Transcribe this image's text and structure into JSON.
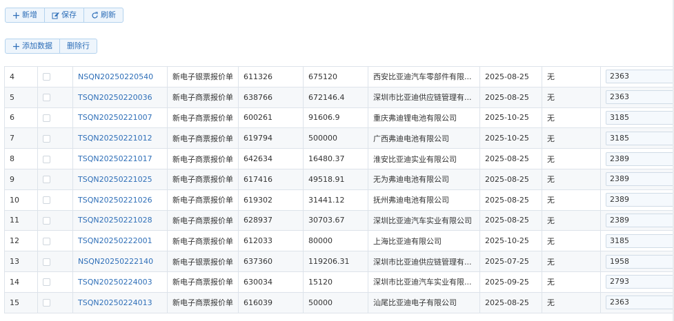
{
  "toolbar": {
    "add_label": "新增",
    "save_label": "保存",
    "refresh_label": "刷新"
  },
  "grid_toolbar": {
    "add_data_label": "添加数据",
    "delete_row_label": "删除行"
  },
  "rows": [
    {
      "num": "4",
      "code": "NSQN20250220540",
      "type": "新电子银票报价单",
      "a": "611326",
      "b": "675120",
      "company": "西安比亚迪汽车零部件有限...",
      "date": "2025-08-25",
      "flag": "无",
      "value": "2363"
    },
    {
      "num": "5",
      "code": "TSQN20250220036",
      "type": "新电子商票报价单",
      "a": "638766",
      "b": "672146.4",
      "company": "深圳市比亚迪供应链管理有...",
      "date": "2025-08-25",
      "flag": "无",
      "value": "2363"
    },
    {
      "num": "6",
      "code": "TSQN20250221007",
      "type": "新电子商票报价单",
      "a": "600261",
      "b": "91606.9",
      "company": "重庆弗迪锂电池有限公司",
      "date": "2025-10-25",
      "flag": "无",
      "value": "3185"
    },
    {
      "num": "7",
      "code": "TSQN20250221012",
      "type": "新电子商票报价单",
      "a": "619794",
      "b": "500000",
      "company": "广西弗迪电池有限公司",
      "date": "2025-10-25",
      "flag": "无",
      "value": "3185"
    },
    {
      "num": "8",
      "code": "TSQN20250221017",
      "type": "新电子商票报价单",
      "a": "642634",
      "b": "16480.37",
      "company": "淮安比亚迪实业有限公司",
      "date": "2025-08-25",
      "flag": "无",
      "value": "2389"
    },
    {
      "num": "9",
      "code": "TSQN20250221025",
      "type": "新电子商票报价单",
      "a": "617416",
      "b": "49518.91",
      "company": "无为弗迪电池有限公司",
      "date": "2025-08-25",
      "flag": "无",
      "value": "2389"
    },
    {
      "num": "10",
      "code": "TSQN20250221026",
      "type": "新电子商票报价单",
      "a": "619302",
      "b": "31441.12",
      "company": "抚州弗迪电池有限公司",
      "date": "2025-08-25",
      "flag": "无",
      "value": "2389"
    },
    {
      "num": "11",
      "code": "TSQN20250221028",
      "type": "新电子商票报价单",
      "a": "628937",
      "b": "30703.67",
      "company": "深圳比亚迪汽车实业有限公司",
      "date": "2025-08-25",
      "flag": "无",
      "value": "2389"
    },
    {
      "num": "12",
      "code": "TSQN20250222001",
      "type": "新电子商票报价单",
      "a": "612033",
      "b": "80000",
      "company": "上海比亚迪有限公司",
      "date": "2025-10-25",
      "flag": "无",
      "value": "3185"
    },
    {
      "num": "13",
      "code": "NSQN20250222140",
      "type": "新电子银票报价单",
      "a": "637360",
      "b": "119206.31",
      "company": "深圳市比亚迪供应链管理有...",
      "date": "2025-07-25",
      "flag": "无",
      "value": "1958"
    },
    {
      "num": "14",
      "code": "TSQN20250224003",
      "type": "新电子商票报价单",
      "a": "630034",
      "b": "15120",
      "company": "深圳市比亚迪汽车实业有限...",
      "date": "2025-09-25",
      "flag": "无",
      "value": "2793"
    },
    {
      "num": "15",
      "code": "TSQN20250224013",
      "type": "新电子商票报价单",
      "a": "616039",
      "b": "50000",
      "company": "汕尾比亚迪电子有限公司",
      "date": "2025-08-25",
      "flag": "无",
      "value": "2363"
    }
  ]
}
